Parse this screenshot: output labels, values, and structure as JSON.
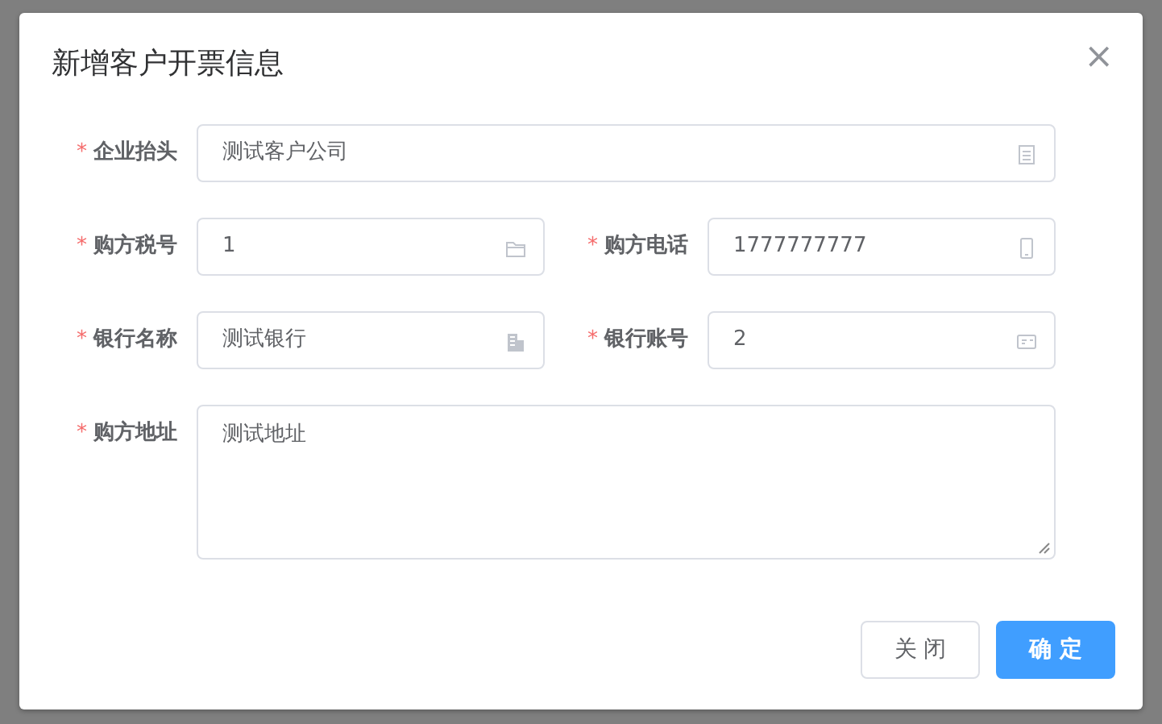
{
  "dialog": {
    "title": "新增客户开票信息",
    "close": "×"
  },
  "form": {
    "rows": [
      [
        {
          "required_mark": "*",
          "label": "企业抬头",
          "value": "测试客户公司",
          "kind": "input"
        }
      ],
      [
        {
          "required_mark": "*",
          "label": "购方税号",
          "value": "1",
          "kind": "input"
        },
        {
          "required_mark": "*",
          "label": "购方电话",
          "value": "1777777777",
          "kind": "input"
        }
      ],
      [
        {
          "required_mark": "*",
          "label": "银行名称",
          "value": "测试银行",
          "kind": "input"
        },
        {
          "required_mark": "*",
          "label": "银行账号",
          "value": "2",
          "kind": "input"
        }
      ],
      [
        {
          "required_mark": "*",
          "label": "购方地址",
          "value": "测试地址",
          "kind": "textarea"
        }
      ]
    ]
  },
  "buttons": [
    {
      "label": "关 闭",
      "primary": false
    },
    {
      "label": "确 定",
      "primary": true
    }
  ]
}
